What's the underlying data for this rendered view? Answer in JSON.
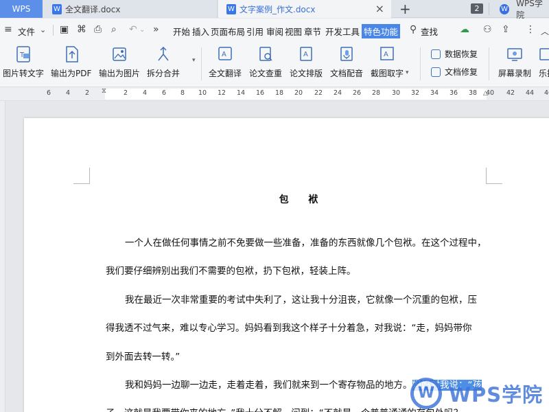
{
  "tabs": {
    "home": "WPS",
    "doc1": "全文翻译.docx",
    "doc2": "文字案例_作文.docx",
    "count": "2",
    "brand": "WPS学院"
  },
  "menu": {
    "file": "文件",
    "items": [
      "开始",
      "插入",
      "页面布局",
      "引用",
      "审阅",
      "视图",
      "章节",
      "开发工具",
      "特色功能"
    ],
    "active": "特色功能",
    "search": "查找"
  },
  "ribbon": {
    "buttons": [
      "图片转文字",
      "输出为PDF",
      "输出为图片",
      "拆分合并",
      "全文翻译",
      "论文查重",
      "论文排版",
      "文档配音",
      "截图取字",
      "屏幕录制",
      "乐排"
    ],
    "small": [
      "数据恢复",
      "文档修复"
    ]
  },
  "ruler": {
    "numbers": [
      "6",
      "4",
      "2",
      "2",
      "4",
      "6",
      "8",
      "10",
      "12",
      "14",
      "16",
      "18",
      "20",
      "22",
      "24",
      "26",
      "28",
      "30",
      "32",
      "34",
      "36",
      "38",
      "40",
      "42",
      "44",
      "46"
    ]
  },
  "document": {
    "title": "包 袱",
    "lines": [
      "一个人在做任何事情之前不免要做一些准备，准备的东西就像几个包袱。在这个过程中，",
      "我们要仔细辨别出我们不需要的包袱，扔下包袱，轻装上阵。",
      "我在最近一次非常重要的考试中失利了，这让我十分沮丧，它就像一个沉重的包袱，压",
      "得我透不过气来，难以专心学习。妈妈看到我这个样子十分着急，对我说：“走，妈妈带你",
      "到外面去转一转。”",
      "我和妈妈一边聊一边走，走着走着，我们就来到一个寄存物品的地方。",
      "妈妈对我说：“孩",
      "子，这就是我要带你来的地方。”我十分不解，问到：“不就是一个普普通通的存包处吗？"
    ]
  },
  "watermark": "WPS学院"
}
